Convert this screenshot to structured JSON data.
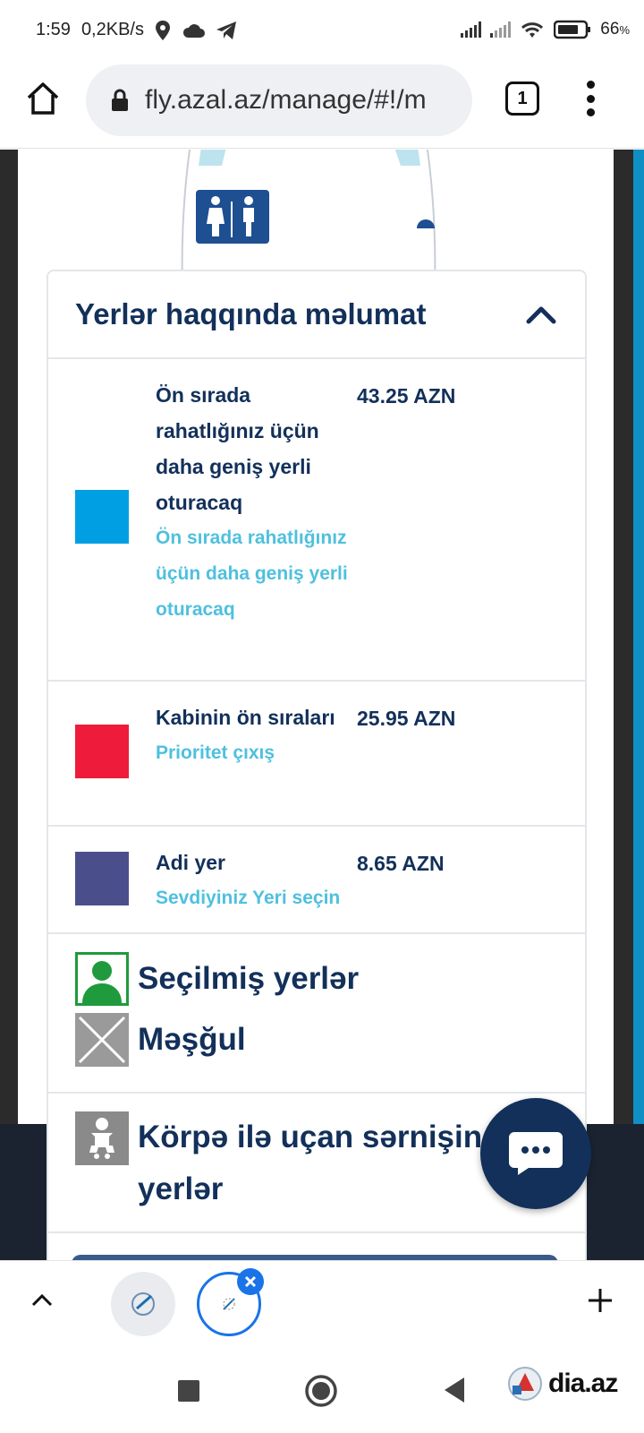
{
  "status_bar": {
    "time": "1:59",
    "net_speed": "0,2KB/s",
    "battery": "66"
  },
  "browser": {
    "url": "fly.azal.az/manage/#!/m",
    "tab_count": "1"
  },
  "legend": {
    "title": "Yerlər haqqında məlumat",
    "rows": [
      {
        "name": "Ön sırada rahatlığınız üçün daha geniş yerli oturacaq",
        "description": "Ön sırada rahatlığınız üçün daha geniş yerli oturacaq",
        "price": "43.25 AZN",
        "color": "#009fe3"
      },
      {
        "name": "Kabinin ön sıraları",
        "description": "Prioritet çıxış",
        "price": "25.95 AZN",
        "color": "#ee1c3a"
      },
      {
        "name": "Adi yer",
        "description": "Sevdiyiniz Yeri seçin",
        "price": "8.65 AZN",
        "color": "#4a4f8c"
      }
    ],
    "selected_label": "Seçilmiş yerlər",
    "occupied_label": "Məşğul",
    "infant_label": "Körpə ilə uçan sərnişin üçün yerlər"
  },
  "watermark": {
    "text": "dia.az"
  },
  "colors": {
    "navy": "#12305a",
    "light_blue_text": "#4fc0de",
    "selected_green": "#1f9a3c",
    "occupied_grey": "#9a9a9a"
  }
}
